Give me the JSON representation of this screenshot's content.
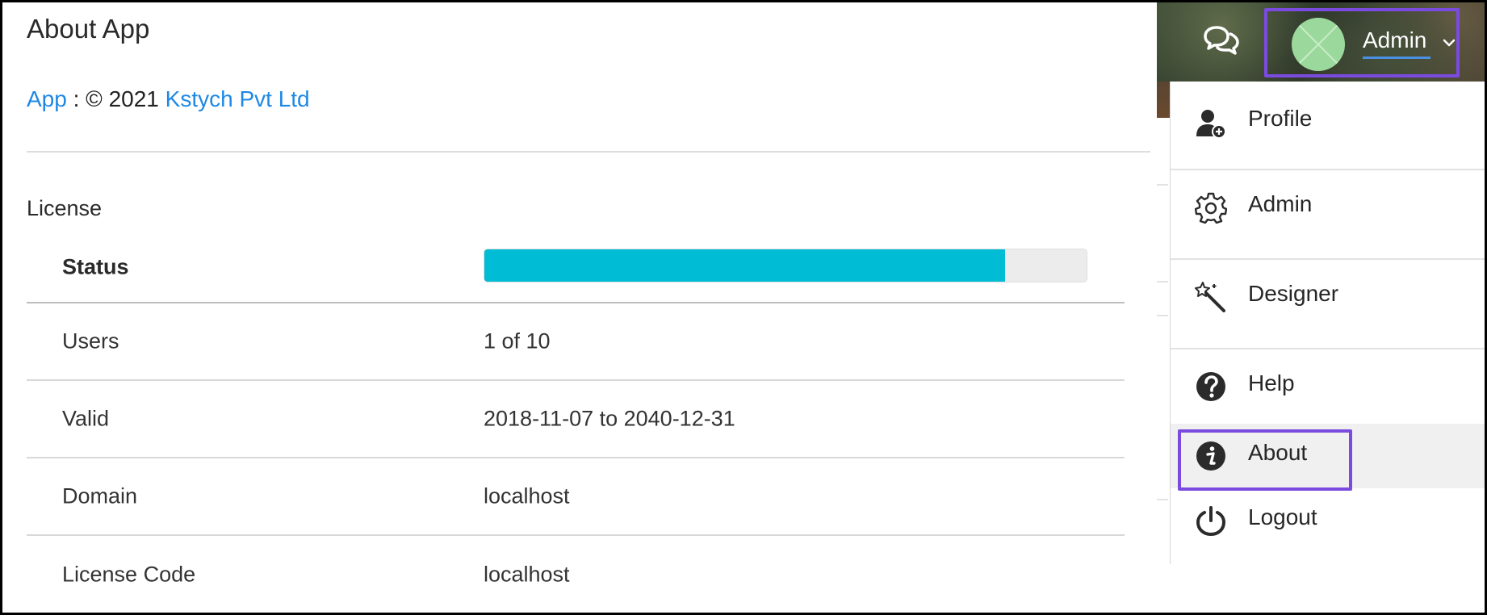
{
  "page": {
    "title": "About App",
    "credit": {
      "app_link": "App",
      "separator": " : © 2021 ",
      "company_link": "Kstych Pvt Ltd"
    },
    "section_label": "License"
  },
  "license_table": {
    "status_label": "Status",
    "status_fill_fraction": 0.865,
    "rows": [
      {
        "key": "Users",
        "value": "1 of 10"
      },
      {
        "key": "Valid",
        "value": "2018-11-07 to 2040-12-31"
      },
      {
        "key": "Domain",
        "value": "localhost"
      },
      {
        "key": "License Code",
        "value": "localhost"
      }
    ]
  },
  "header": {
    "user_name": "Admin",
    "icons": {
      "chat": "chat-bubbles-icon",
      "caret": "chevron-down-icon"
    }
  },
  "menu": {
    "items": [
      {
        "label": "Profile",
        "icon": "user-plus-icon"
      },
      {
        "label": "Admin",
        "icon": "gear-icon"
      },
      {
        "label": "Designer",
        "icon": "magic-wand-icon"
      },
      {
        "label": "Help",
        "icon": "question-circle-icon"
      },
      {
        "label": "About",
        "icon": "info-circle-icon"
      },
      {
        "label": "Logout",
        "icon": "power-icon"
      }
    ]
  },
  "colors": {
    "link": "#1e88e5",
    "progress": "#00bcd4",
    "highlight": "#7b4be0",
    "avatar": "#9bd89b"
  }
}
